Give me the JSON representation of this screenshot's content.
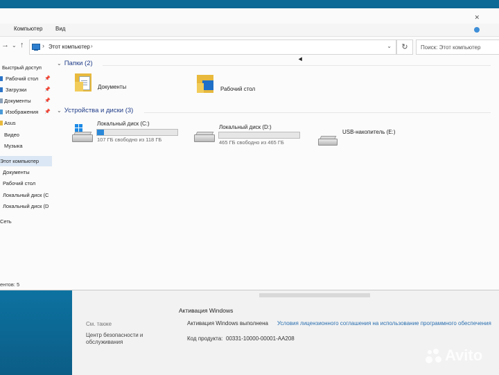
{
  "ribbon": {
    "tabs": [
      "Компьютер",
      "Вид"
    ]
  },
  "address": {
    "crumb": "Этот компьютер",
    "search_placeholder": "Поиск: Этот компьютер"
  },
  "sidebar": {
    "items": [
      {
        "label": "Быстрый доступ",
        "pinned": false,
        "icon": "star-icon"
      },
      {
        "label": "Рабочий стол",
        "pinned": true,
        "icon": "desktop-folder-icon"
      },
      {
        "label": "Загрузки",
        "pinned": true,
        "icon": "download-icon"
      },
      {
        "label": "Документы",
        "pinned": true,
        "icon": "documents-icon"
      },
      {
        "label": "Изображения",
        "pinned": true,
        "icon": "pictures-icon"
      },
      {
        "label": "Asus",
        "pinned": false,
        "icon": "folder-icon"
      },
      {
        "label": "Видео",
        "pinned": false,
        "icon": "folder-icon"
      },
      {
        "label": "Музыка",
        "pinned": false,
        "icon": "folder-icon"
      },
      {
        "label": "Этот компьютер",
        "pinned": false,
        "icon": "computer-icon"
      },
      {
        "label": "Документы",
        "pinned": false,
        "icon": "documents-icon"
      },
      {
        "label": "Рабочий стол",
        "pinned": false,
        "icon": "desktop-folder-icon"
      },
      {
        "label": "Локальный диск (C",
        "pinned": false,
        "icon": "drive-icon"
      },
      {
        "label": "Локальный диск (D",
        "pinned": false,
        "icon": "drive-icon"
      },
      {
        "label": "Сеть",
        "pinned": false,
        "icon": "network-icon"
      }
    ],
    "status": "ентов: 5"
  },
  "folders": {
    "header": "Папки (2)",
    "items": [
      {
        "name": "Документы",
        "icon": "documents-folder-icon"
      },
      {
        "name": "Рабочий стол",
        "icon": "desktop-folder-icon"
      }
    ]
  },
  "drives": {
    "header": "Устройства и диски (3)",
    "items": [
      {
        "name": "Локальный диск (C:)",
        "free": "107 ГБ свободно из 118 ГБ",
        "used_fraction": 0.09,
        "icon": "windows-drive-icon"
      },
      {
        "name": "Локальный диск (D:)",
        "free": "465 ГБ свободно из 465 ГБ",
        "used_fraction": 0.0,
        "icon": "drive-icon"
      },
      {
        "name": "USB-накопитель (E:)",
        "free": "",
        "used_fraction": null,
        "icon": "usb-drive-icon"
      }
    ]
  },
  "system_window": {
    "activation_title": "Активация Windows",
    "see_also": "См. также",
    "security_center": "Центр безопасности и обслуживания",
    "activation_status": "Активация Windows выполнена",
    "license_link": "Условия лицензионного соглашения на использование программного обеспечения",
    "product_label": "Код продукта:",
    "product_id": "00331-10000-00001-AA208"
  },
  "watermark": "Avito",
  "colors": {
    "accent": "#2a88d8",
    "selection": "#dbe7f4",
    "header": "#1f3c88",
    "link": "#2a6fb0"
  }
}
